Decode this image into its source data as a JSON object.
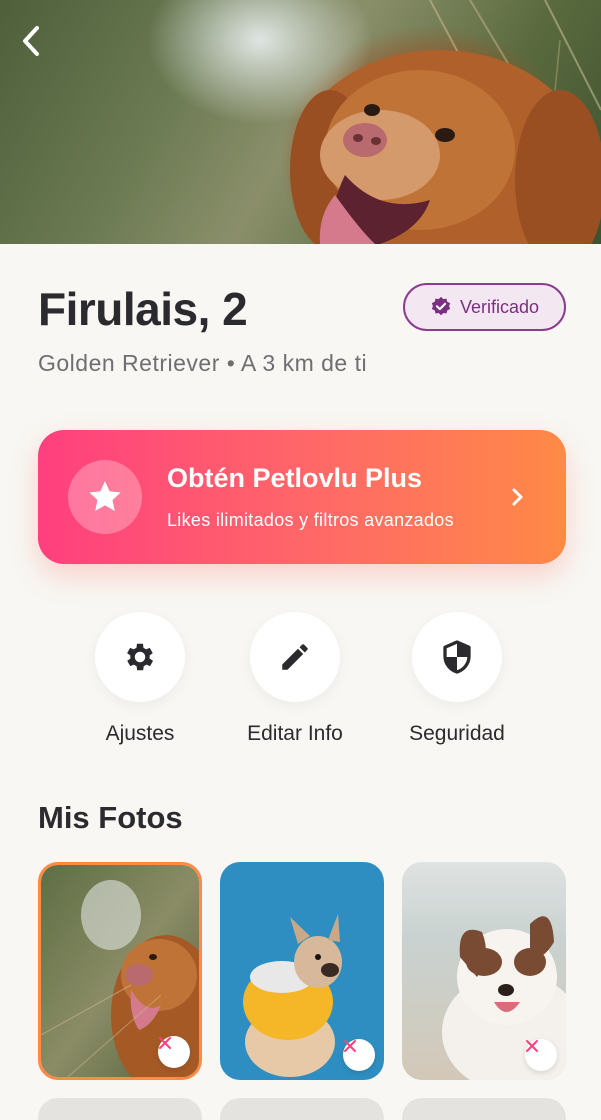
{
  "header": {
    "back_icon": "chevron-left-icon"
  },
  "profile": {
    "name_age": "Firulais, 2",
    "subtitle": "Golden Retriever • A 3 km de ti",
    "badge": {
      "label": "Verificado",
      "icon": "verified-badge-icon"
    }
  },
  "promo": {
    "title": "Obtén Petlovlu Plus",
    "subtitle": "Likes ilimitados y filtros avanzados",
    "icon": "star-icon",
    "arrow_icon": "chevron-right-icon"
  },
  "actions": [
    {
      "label": "Ajustes",
      "icon": "gear-icon"
    },
    {
      "label": "Editar Info",
      "icon": "pencil-icon"
    },
    {
      "label": "Seguridad",
      "icon": "shield-icon"
    }
  ],
  "photos": {
    "title": "Mis Fotos",
    "items": [
      {
        "subject": "brown retriever dog",
        "selected": true
      },
      {
        "subject": "french bulldog in yellow hoodie",
        "selected": false
      },
      {
        "subject": "brown and white collie dog",
        "selected": false
      }
    ]
  },
  "colors": {
    "accent_pink": "#ff3f7f",
    "accent_orange": "#ff8a46",
    "verified_purple": "#7b2f80",
    "background": "#f8f7f3",
    "text_dark": "#2b2b2f"
  }
}
